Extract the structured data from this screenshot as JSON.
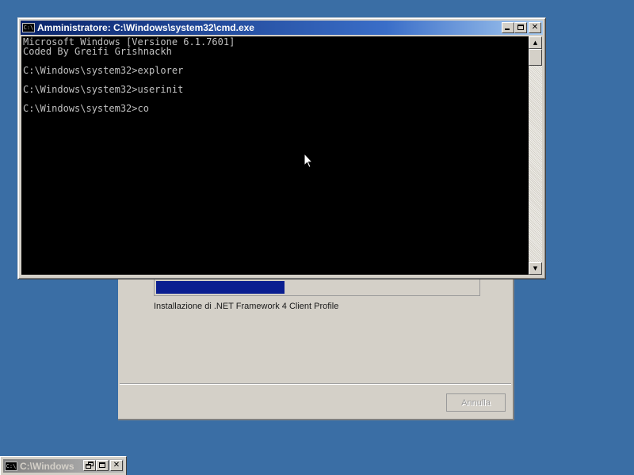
{
  "desktop": {
    "background": "#3a6ea5"
  },
  "installer": {
    "progress_fraction": 0.4,
    "status_text": "Installazione di .NET Framework 4 Client Profile",
    "cancel_label": "Annulla",
    "cancel_enabled": false,
    "progress_color": "#0a1e90"
  },
  "cmd": {
    "title": "Amministratore: C:\\Windows\\system32\\cmd.exe",
    "icon_text": "C:\\",
    "close_glyph": "✕",
    "lines": [
      "Microsoft Windows [Versione 6.1.7601]",
      "Coded By Greifi Grishnackh",
      "",
      "C:\\Windows\\system32>explorer",
      "",
      "C:\\Windows\\system32>userinit",
      "",
      "C:\\Windows\\system32>co"
    ],
    "text_color": "#c0c0c0",
    "background": "#000000"
  },
  "minimized": {
    "title": "C:\\Windows",
    "icon_text": "C:\\",
    "close_glyph": "✕"
  }
}
